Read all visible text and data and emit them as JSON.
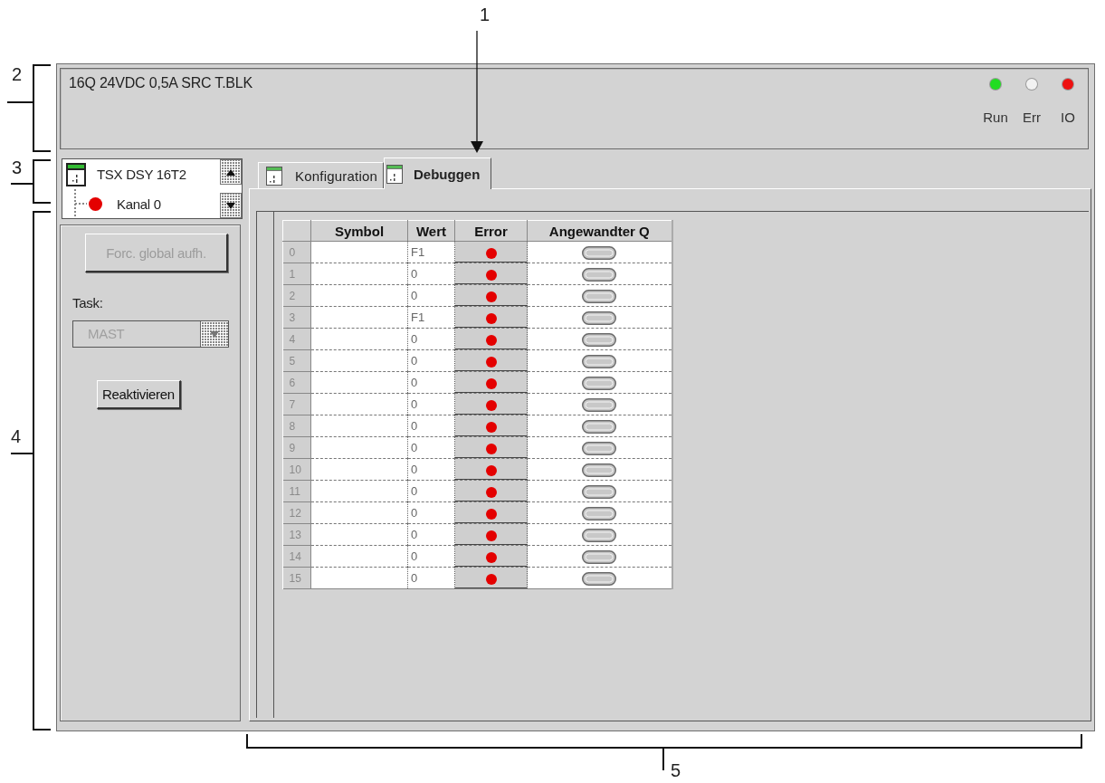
{
  "callouts": [
    {
      "label": "1",
      "kind": "arrow"
    },
    {
      "label": "2",
      "kind": "side_bracket"
    },
    {
      "label": "3",
      "kind": "side_bracket"
    },
    {
      "label": "4",
      "kind": "side_bracket"
    },
    {
      "label": "5",
      "kind": "bottom_bracket"
    }
  ],
  "module": {
    "title": "16Q 24VDC 0,5A SRC T.BLK",
    "leds": [
      {
        "label": "Run",
        "color": "#22dd22"
      },
      {
        "label": "Err",
        "color": "#f2f2f2"
      },
      {
        "label": "IO",
        "color": "#ee1111"
      }
    ]
  },
  "tree": {
    "items": [
      {
        "label": "TSX DSY 16T2",
        "children": [
          {
            "label": "Kanal 0",
            "error": true
          }
        ]
      }
    ]
  },
  "left_panel": {
    "force_button": {
      "label": "Forc. global aufh.",
      "disabled": true
    },
    "task": {
      "label": "Task:",
      "value": "MAST",
      "disabled": true
    },
    "reactivate_button": {
      "label": "Reaktivieren",
      "disabled": false
    }
  },
  "tabs": [
    {
      "label": "Konfiguration",
      "selected": false
    },
    {
      "label": "Debuggen",
      "selected": true
    }
  ],
  "table": {
    "columns": [
      "Symbol",
      "Wert",
      "Error",
      "Angewandter Q"
    ],
    "rows": [
      {
        "index": "0",
        "value": "F1",
        "error": true
      },
      {
        "index": "1",
        "value": "0",
        "error": true
      },
      {
        "index": "2",
        "value": "0",
        "error": true
      },
      {
        "index": "3",
        "value": "F1",
        "error": true
      },
      {
        "index": "4",
        "value": "0",
        "error": true
      },
      {
        "index": "5",
        "value": "0",
        "error": true
      },
      {
        "index": "6",
        "value": "0",
        "error": true
      },
      {
        "index": "7",
        "value": "0",
        "error": true
      },
      {
        "index": "8",
        "value": "0",
        "error": true
      },
      {
        "index": "9",
        "value": "0",
        "error": true
      },
      {
        "index": "10",
        "value": "0",
        "error": true
      },
      {
        "index": "11",
        "value": "0",
        "error": true
      },
      {
        "index": "12",
        "value": "0",
        "error": true
      },
      {
        "index": "13",
        "value": "0",
        "error": true
      },
      {
        "index": "14",
        "value": "0",
        "error": true
      },
      {
        "index": "15",
        "value": "0",
        "error": true
      }
    ]
  }
}
